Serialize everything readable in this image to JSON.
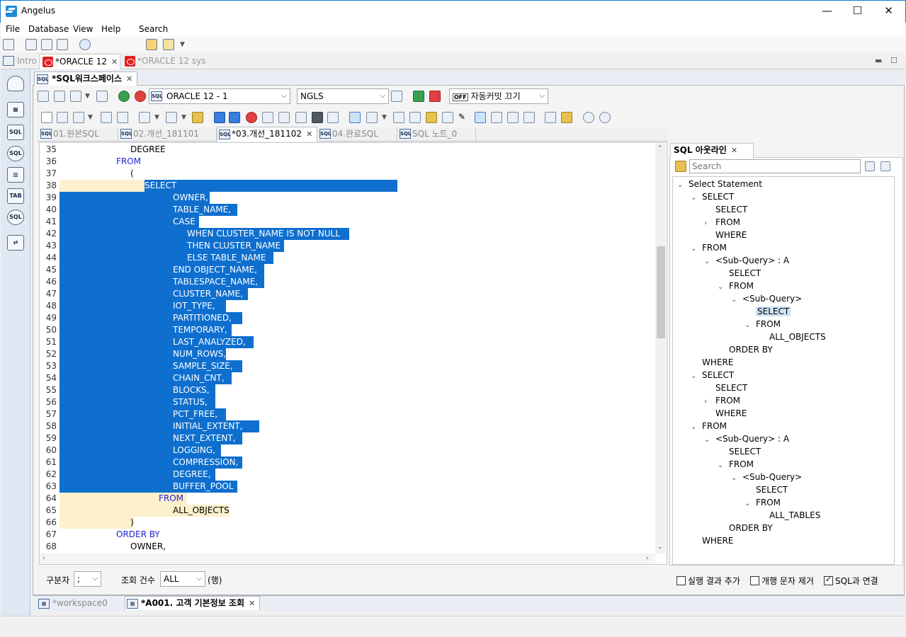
{
  "window": {
    "title": "Angelus",
    "minimize": "—",
    "maximize": "☐",
    "close": "✕"
  },
  "menu": {
    "file": "File",
    "database": "Database",
    "view": "View",
    "help": "Help",
    "search": "Search"
  },
  "perspective_tabs": [
    {
      "label": "Intro"
    },
    {
      "label": "*ORACLE 12"
    },
    {
      "label": "*ORACLE 12 sys"
    }
  ],
  "workspace": {
    "tab_label": "*SQL워크스페이스",
    "connection": "ORACLE 12 - 1",
    "nls": "NGLS",
    "autocommit": "자동커밋 끄기",
    "autocommit_badge": "OFF"
  },
  "editor_tabs": [
    {
      "label": "01.원본SQL"
    },
    {
      "label": "02.개선_181101"
    },
    {
      "label": "*03.개선_181102"
    },
    {
      "label": "04.완료SQL"
    },
    {
      "label": "SQL 노트_0"
    }
  ],
  "code_lines": [
    {
      "n": "35",
      "text": "DEGREE"
    },
    {
      "n": "36",
      "text": "FROM"
    },
    {
      "n": "37",
      "text": "("
    },
    {
      "n": "38",
      "text": "SELECT"
    },
    {
      "n": "39",
      "text": "OWNER,"
    },
    {
      "n": "40",
      "text": "TABLE_NAME,"
    },
    {
      "n": "41",
      "text": "CASE"
    },
    {
      "n": "42",
      "text": "WHEN CLUSTER_NAME IS NOT NULL"
    },
    {
      "n": "43",
      "text": "THEN CLUSTER_NAME"
    },
    {
      "n": "44",
      "text": "ELSE TABLE_NAME"
    },
    {
      "n": "45",
      "text": "END OBJECT_NAME,"
    },
    {
      "n": "46",
      "text": "TABLESPACE_NAME,"
    },
    {
      "n": "47",
      "text": "CLUSTER_NAME,"
    },
    {
      "n": "48",
      "text": "IOT_TYPE,"
    },
    {
      "n": "49",
      "text": "PARTITIONED,"
    },
    {
      "n": "50",
      "text": "TEMPORARY,"
    },
    {
      "n": "51",
      "text": "LAST_ANALYZED,"
    },
    {
      "n": "52",
      "text": "NUM_ROWS,"
    },
    {
      "n": "53",
      "text": "SAMPLE_SIZE,"
    },
    {
      "n": "54",
      "text": "CHAIN_CNT,"
    },
    {
      "n": "55",
      "text": "BLOCKS,"
    },
    {
      "n": "56",
      "text": "STATUS,"
    },
    {
      "n": "57",
      "text": "PCT_FREE,"
    },
    {
      "n": "58",
      "text": "INITIAL_EXTENT,"
    },
    {
      "n": "59",
      "text": "NEXT_EXTENT,"
    },
    {
      "n": "60",
      "text": "LOGGING,"
    },
    {
      "n": "61",
      "text": "COMPRESSION,"
    },
    {
      "n": "62",
      "text": "DEGREE,"
    },
    {
      "n": "63",
      "text": "BUFFER_POOL"
    },
    {
      "n": "64",
      "text": "FROM"
    },
    {
      "n": "65",
      "text": "ALL_OBJECTS"
    },
    {
      "n": "66",
      "text": ")"
    },
    {
      "n": "67",
      "text": "ORDER BY"
    },
    {
      "n": "68",
      "text": "OWNER,"
    }
  ],
  "outline": {
    "tab_label": "SQL 아웃라인",
    "search_placeholder": "Search",
    "nodes": [
      {
        "label": "Select Statement",
        "twisty": "v"
      },
      {
        "label": "SELECT",
        "twisty": "v"
      },
      {
        "label": "SELECT",
        "twisty": ""
      },
      {
        "label": "FROM",
        "twisty": ">"
      },
      {
        "label": "WHERE",
        "twisty": ""
      },
      {
        "label": "FROM",
        "twisty": "v"
      },
      {
        "label": "<Sub-Query> : A",
        "twisty": "v"
      },
      {
        "label": "SELECT",
        "twisty": ""
      },
      {
        "label": "FROM",
        "twisty": "v"
      },
      {
        "label": "<Sub-Query>",
        "twisty": "v"
      },
      {
        "label": "SELECT",
        "twisty": ""
      },
      {
        "label": "FROM",
        "twisty": "v"
      },
      {
        "label": "ALL_OBJECTS",
        "twisty": ""
      },
      {
        "label": "ORDER BY",
        "twisty": ""
      },
      {
        "label": "WHERE",
        "twisty": ""
      },
      {
        "label": "SELECT",
        "twisty": "v"
      },
      {
        "label": "SELECT",
        "twisty": ""
      },
      {
        "label": "FROM",
        "twisty": ">"
      },
      {
        "label": "WHERE",
        "twisty": ""
      },
      {
        "label": "FROM",
        "twisty": "v"
      },
      {
        "label": "<Sub-Query> : A",
        "twisty": "v"
      },
      {
        "label": "SELECT",
        "twisty": ""
      },
      {
        "label": "FROM",
        "twisty": "v"
      },
      {
        "label": "<Sub-Query>",
        "twisty": "v"
      },
      {
        "label": "SELECT",
        "twisty": ""
      },
      {
        "label": "FROM",
        "twisty": "v"
      },
      {
        "label": "ALL_TABLES",
        "twisty": ""
      },
      {
        "label": "ORDER BY",
        "twisty": ""
      },
      {
        "label": "WHERE",
        "twisty": ""
      }
    ]
  },
  "bottom": {
    "delimiter_label": "구분자",
    "delimiter_value": ";",
    "fetch_label": "조회 건수",
    "fetch_value": "ALL",
    "fetch_unit": "(행)",
    "opt_append": "실행 결과 추가",
    "opt_strip_newline": "개행 문자 제거",
    "opt_link_sql": "SQL과 연결"
  },
  "bottom_tabs": [
    {
      "label": "*workspace0"
    },
    {
      "label": "*A001. 고객 기본정보 조회"
    }
  ],
  "colors": {
    "selection": "#0f6fce",
    "current_line": "#fdf0cc",
    "keyword": "#2222cc"
  }
}
